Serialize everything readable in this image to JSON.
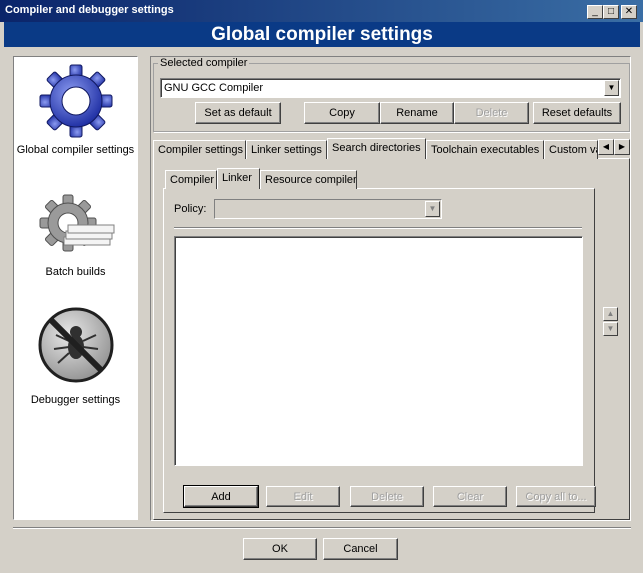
{
  "window": {
    "title": "Compiler and debugger settings"
  },
  "banner": "Global compiler settings",
  "sidebar": {
    "items": [
      {
        "label": "Global compiler settings",
        "icon": "gear-icon"
      },
      {
        "label": "Batch builds",
        "icon": "batch-gear-icon"
      },
      {
        "label": "Debugger settings",
        "icon": "no-bug-icon"
      }
    ]
  },
  "compiler": {
    "group_label": "Selected compiler",
    "selected": "GNU GCC Compiler",
    "buttons": {
      "set_default": "Set as default",
      "copy": "Copy",
      "rename": "Rename",
      "delete": "Delete",
      "reset": "Reset defaults"
    }
  },
  "tabs": [
    "Compiler settings",
    "Linker settings",
    "Search directories",
    "Toolchain executables",
    "Custom va"
  ],
  "subtabs": [
    "Compiler",
    "Linker",
    "Resource compiler"
  ],
  "policy": {
    "label": "Policy:",
    "value": ""
  },
  "list_buttons": {
    "add": "Add",
    "edit": "Edit",
    "delete": "Delete",
    "clear": "Clear",
    "copy_all": "Copy all to..."
  },
  "footer": {
    "ok": "OK",
    "cancel": "Cancel"
  }
}
